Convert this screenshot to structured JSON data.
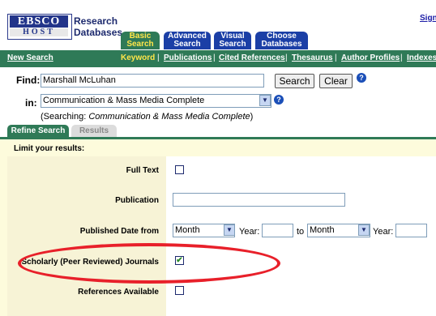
{
  "header": {
    "logo_top": "EBSCO",
    "logo_bottom": "HOST",
    "brand_line1": "Research",
    "brand_line2": "Databases",
    "sign_in": "Sign"
  },
  "tabs": [
    {
      "line1": "Basic",
      "line2": "Search"
    },
    {
      "line1": "Advanced",
      "line2": "Search"
    },
    {
      "line1": "Visual",
      "line2": "Search"
    },
    {
      "line1": "Choose",
      "line2": "Databases"
    }
  ],
  "nav": {
    "new_search": "New Search",
    "keyword": "Keyword",
    "items": [
      "Publications",
      "Cited References",
      "Thesaurus",
      "Author Profiles",
      "Indexes"
    ],
    "separator": "|"
  },
  "find": {
    "label": "Find:",
    "value": "Marshall McLuhan",
    "search_button": "Search",
    "clear_button": "Clear",
    "help": "?"
  },
  "in": {
    "label": "in:",
    "selected": "Communication & Mass Media Complete",
    "searching_prefix": "(Searching:",
    "searching_value": "Communication & Mass Media Complete",
    "searching_suffix": ")"
  },
  "result_tabs": {
    "refine": "Refine Search",
    "results": "Results"
  },
  "limits": {
    "heading": "Limit your results:",
    "full_text": "Full Text",
    "publication": "Publication",
    "published_date": "Published Date from",
    "month1": "Month",
    "year_label1": "Year:",
    "to": "to",
    "month2": "Month",
    "year_label2": "Year:",
    "scholarly": "Scholarly (Peer Reviewed) Journals",
    "scholarly_checked": "✔",
    "references": "References Available"
  }
}
